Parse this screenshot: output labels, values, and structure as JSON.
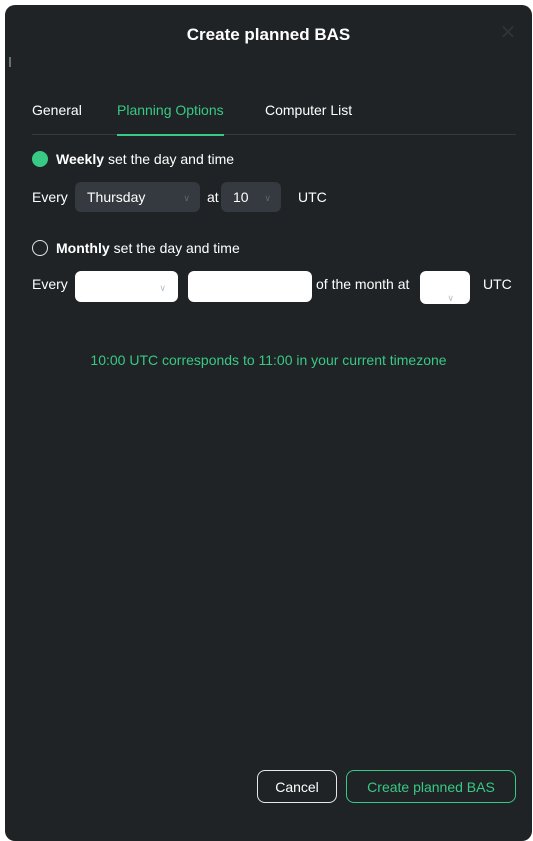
{
  "dialog": {
    "title": "Create planned BAS",
    "close_icon": "close-icon"
  },
  "tabs": [
    {
      "label": "General",
      "active": false
    },
    {
      "label": "Planning Options",
      "active": true
    },
    {
      "label": "Computer List",
      "active": false
    }
  ],
  "weekly": {
    "selected": true,
    "bold": "Weekly",
    "rest": "set the day and time",
    "every_label": "Every",
    "day_value": "Thursday",
    "at_label": "at",
    "hour_value": "10",
    "utc_label": "UTC"
  },
  "monthly": {
    "selected": false,
    "bold": "Monthly",
    "rest": "set the day and time",
    "every_label": "Every",
    "ordinal_value": "",
    "day_value": "",
    "month_label": "of the month at",
    "hour_value": "",
    "utc_label": "UTC"
  },
  "timezone_note": "10:00 UTC corresponds to 11:00 in your current timezone",
  "footer": {
    "cancel_label": "Cancel",
    "create_label": "Create planned BAS"
  },
  "colors": {
    "accent": "#38c984",
    "background": "#1f2326",
    "control": "#343a3f"
  }
}
